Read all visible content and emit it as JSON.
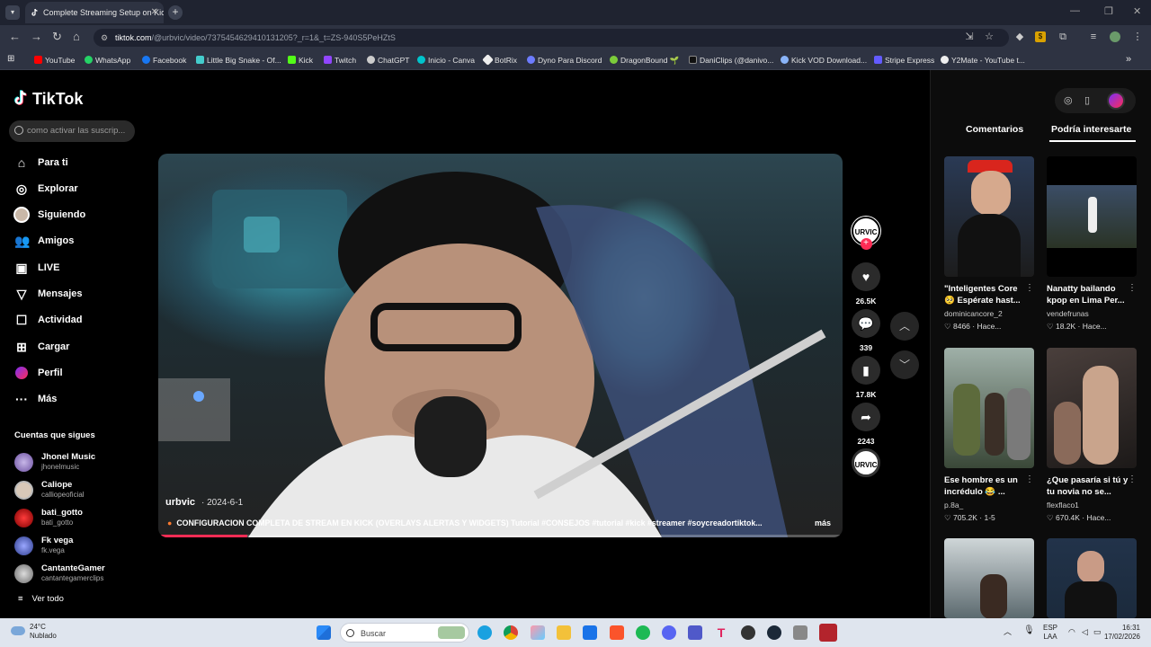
{
  "browser": {
    "tab_title": "Complete Streaming Setup on Kick",
    "url_host": "tiktok.com",
    "url_path": "/@urbvic/video/7375454629410131205?_r=1&_t=ZS-940S5PeHZtS",
    "bookmarks": [
      "YouTube",
      "WhatsApp",
      "Facebook",
      "Little Big Snake - Of...",
      "Kick",
      "Twitch",
      "ChatGPT",
      "Inicio - Canva",
      "BotRix",
      "Dyno Para Discord",
      "DragonBound 🌱",
      "DaniClips (@danivo...",
      "Kick VOD Download...",
      "Stripe Express",
      "Y2Mate - YouTube t..."
    ]
  },
  "sidebar": {
    "logo": "TikTok",
    "search_placeholder": "como activar las suscrip...",
    "nav": [
      "Para ti",
      "Explorar",
      "Siguiendo",
      "Amigos",
      "LIVE",
      "Mensajes",
      "Actividad",
      "Cargar",
      "Perfil",
      "Más"
    ],
    "following_title": "Cuentas que sigues",
    "following": [
      {
        "name": "Jhonel Music",
        "handle": "jhonelmusic"
      },
      {
        "name": "Caliope",
        "handle": "calliopeoficial"
      },
      {
        "name": "bati_gotto",
        "handle": "bati_gotto"
      },
      {
        "name": "Fk vega",
        "handle": "fk.vega"
      },
      {
        "name": "CantanteGamer",
        "handle": "cantantegamerclips"
      }
    ],
    "see_all": "Ver todo"
  },
  "video": {
    "author": "urbvic",
    "date": "· 2024-6-1",
    "description": "CONFIGURACION COMPLETA DE STREAM EN KICK (OVERLAYS ALERTAS Y WIDGETS) Tutorial #CONSEJOS #tutorial #kick #streamer #soycreadortiktok...",
    "more": "más",
    "progress": 0.13
  },
  "actions": {
    "likes": "26.5K",
    "comments": "339",
    "saves": "17.8K",
    "shares": "2243"
  },
  "right_panel": {
    "tab_comments": "Comentarios",
    "tab_recommended": "Podría interesarte",
    "cards": [
      {
        "title": "\"Inteligentes Core 🥺 Espérate hast...",
        "user": "dominicancore_2",
        "stats": "8466 · Hace..."
      },
      {
        "title": "Nanatty bailando kpop en Lima Per...",
        "user": "vendefrunas",
        "stats": "18.2K · Hace..."
      },
      {
        "title": "Ese hombre es un incrédulo 😂 ...",
        "user": "p.8a_",
        "stats": "705.2K · 1-5"
      },
      {
        "title": "¿Que pasaría si tú y tu novia no se...",
        "user": "flexflaco1",
        "stats": "670.4K · Hace..."
      }
    ]
  },
  "taskbar": {
    "temp": "24°C",
    "weather": "Nublado",
    "search": "Buscar",
    "lang1": "ESP",
    "lang2": "LAA",
    "time": "16:31",
    "date": "17/02/2026"
  }
}
